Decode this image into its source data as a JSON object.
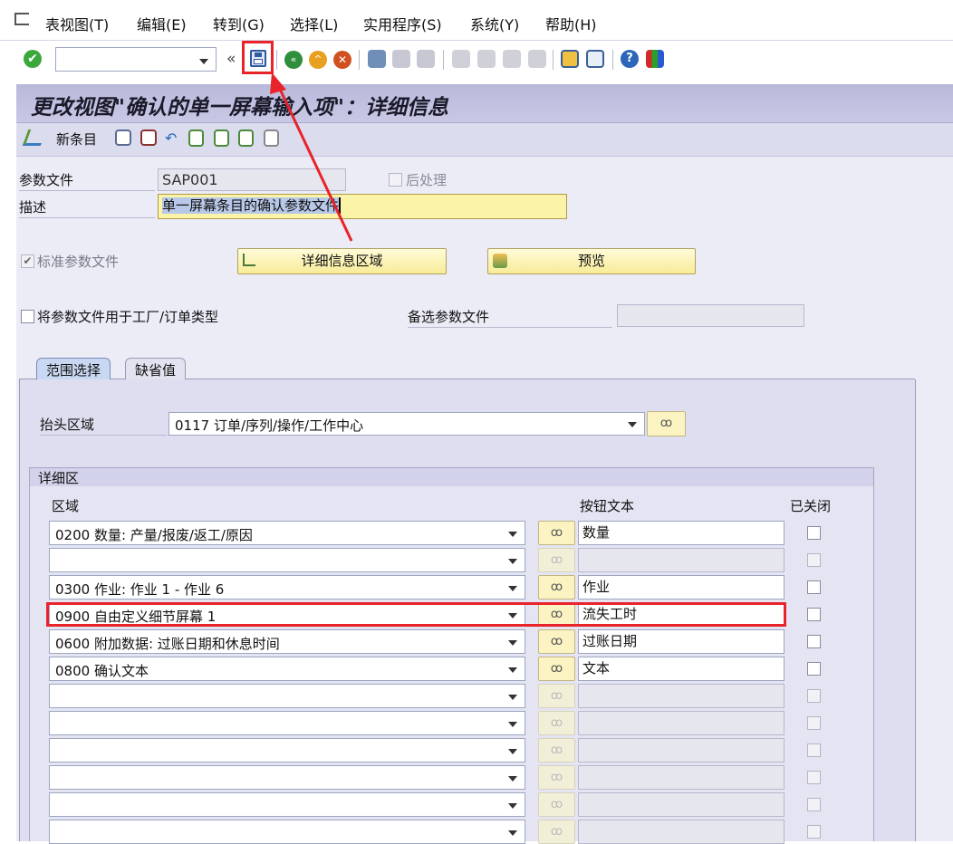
{
  "menu": [
    "表视图(T)",
    "编辑(E)",
    "转到(G)",
    "选择(L)",
    "实用程序(S)",
    "系统(Y)",
    "帮助(H)"
  ],
  "toolbar": {
    "command_value": "",
    "icons": [
      "enter-icon",
      "save-icon",
      "back-icon",
      "exit-icon",
      "cancel-icon",
      "print-icon",
      "find-icon",
      "find-next-icon",
      "first-page-icon",
      "previous-page-icon",
      "next-page-icon",
      "last-page-icon",
      "create-session-icon",
      "shortcut-icon",
      "help-icon",
      "layout-icon"
    ]
  },
  "screen": {
    "title": "更改视图\"确认的单一屏幕输入项\"：详细信息"
  },
  "app_toolbar": {
    "new_entries": "新条目"
  },
  "form": {
    "profile_label": "参数文件",
    "profile_value": "SAP001",
    "postprocess_label": "后处理",
    "postprocess_checked": false,
    "desc_label": "描述",
    "desc_value": "单一屏幕条目的确认参数文件",
    "std_profile_label": "标准参数文件",
    "std_profile_checked": true,
    "detail_area_button": "详细信息区域",
    "preview_button": "预览",
    "plant_order_label": "将参数文件用于工厂/订单类型",
    "plant_order_checked": false,
    "alt_profile_label": "备选参数文件",
    "alt_profile_value": ""
  },
  "tabs": [
    {
      "label": "范围选择",
      "active": true
    },
    {
      "label": "缺省值",
      "active": false
    }
  ],
  "header_area": {
    "label": "抬头区域",
    "value": "0117 订单/序列/操作/工作中心"
  },
  "detail_area": {
    "group_title": "详细区",
    "col_area": "区域",
    "col_button_text": "按钮文本",
    "col_closed": "已关闭",
    "rows": [
      {
        "area": "0200 数量: 产量/报废/返工/原因",
        "button_text": "数量"
      },
      {
        "area": "",
        "button_text": ""
      },
      {
        "area": "0300 作业: 作业 1 - 作业 6",
        "button_text": "作业"
      },
      {
        "area": "0900 自由定义细节屏幕 1",
        "button_text": "流失工时"
      },
      {
        "area": "0600 附加数据: 过账日期和休息时间",
        "button_text": "过账日期"
      },
      {
        "area": "0800 确认文本",
        "button_text": "文本"
      },
      {
        "area": "",
        "button_text": ""
      },
      {
        "area": "",
        "button_text": ""
      },
      {
        "area": "",
        "button_text": ""
      },
      {
        "area": "",
        "button_text": ""
      },
      {
        "area": "",
        "button_text": ""
      },
      {
        "area": "",
        "button_text": ""
      }
    ]
  },
  "colors": {
    "highlight": "#e8232a",
    "title_bg": "#c0c0e0",
    "button_yellow": "#f8eb98"
  }
}
